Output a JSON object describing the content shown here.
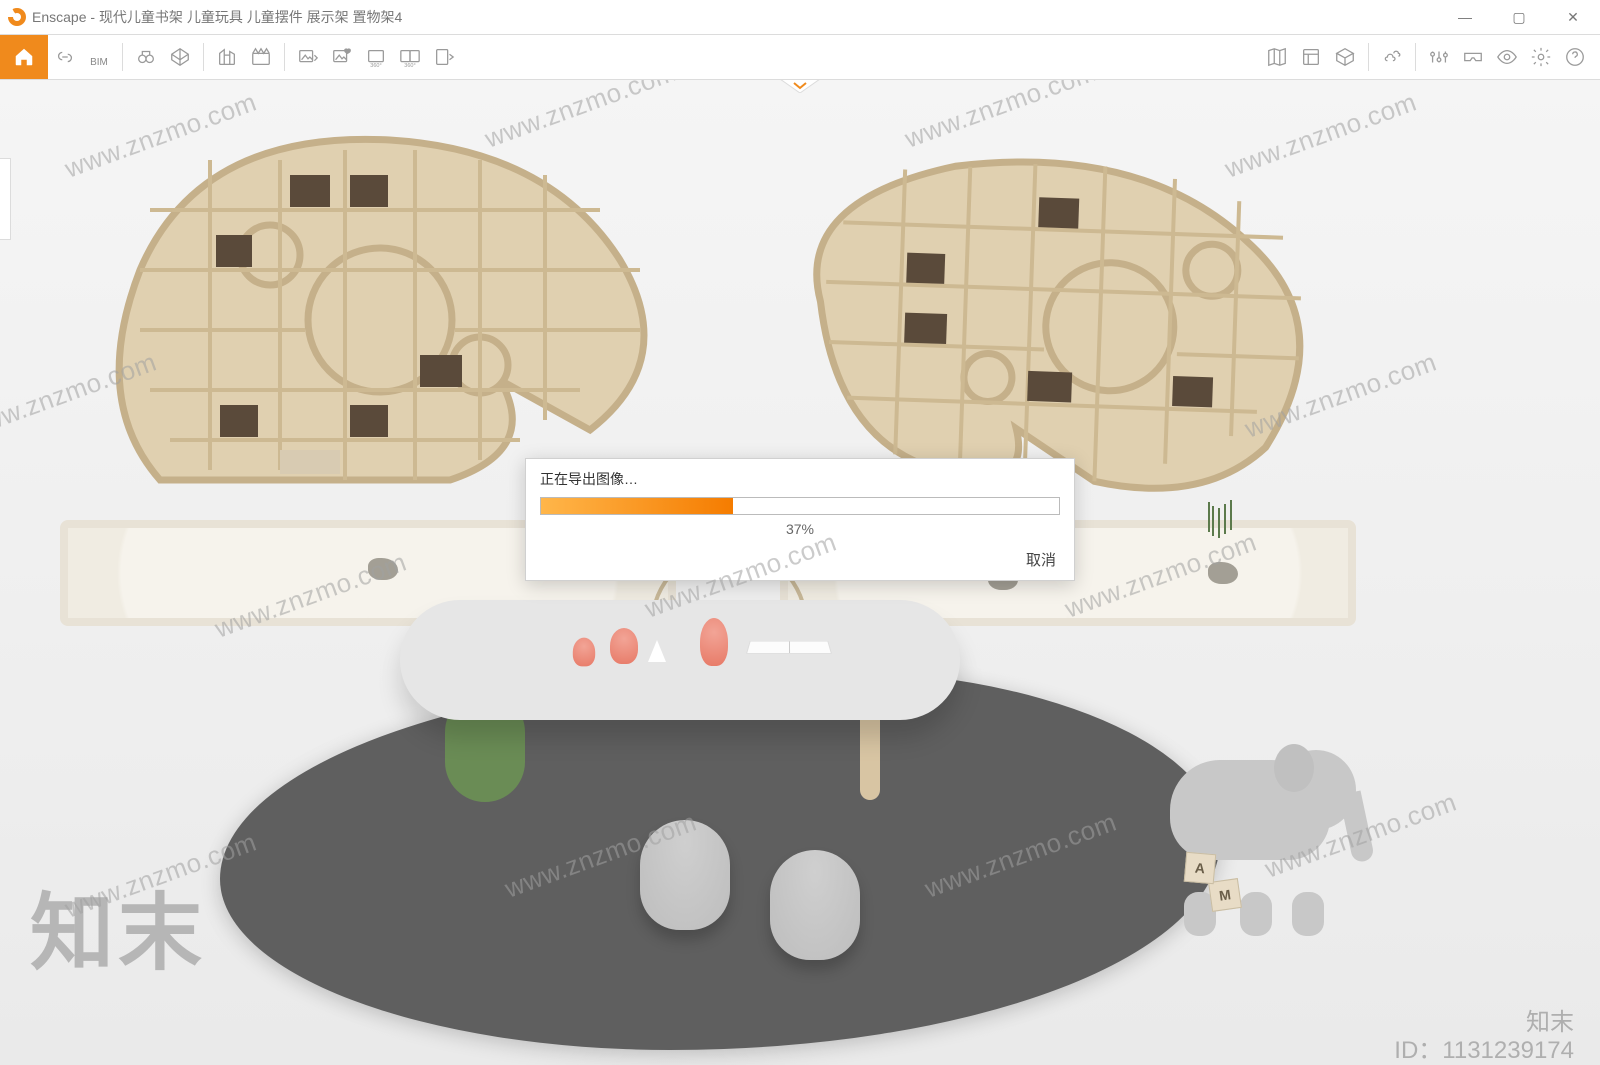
{
  "titlebar": {
    "app_name": "Enscape",
    "document_title": "现代儿童书架 儿童玩具 儿童摆件 展示架 置物架4",
    "separator": " - "
  },
  "window_controls": {
    "minimize_glyph": "—",
    "maximize_glyph": "▢",
    "close_glyph": "✕"
  },
  "toolbar_left": {
    "bim_label": "BIM"
  },
  "dialog": {
    "title": "正在导出图像…",
    "percent_value": 37,
    "percent_label": "37%",
    "cancel_label": "取消"
  },
  "scene": {
    "block_letter_1": "M",
    "block_letter_2": "A"
  },
  "watermark": {
    "text": "www.znzmo.com",
    "brand_big": "知末",
    "brand_small": "知末",
    "id_label": "ID：1131239174"
  }
}
